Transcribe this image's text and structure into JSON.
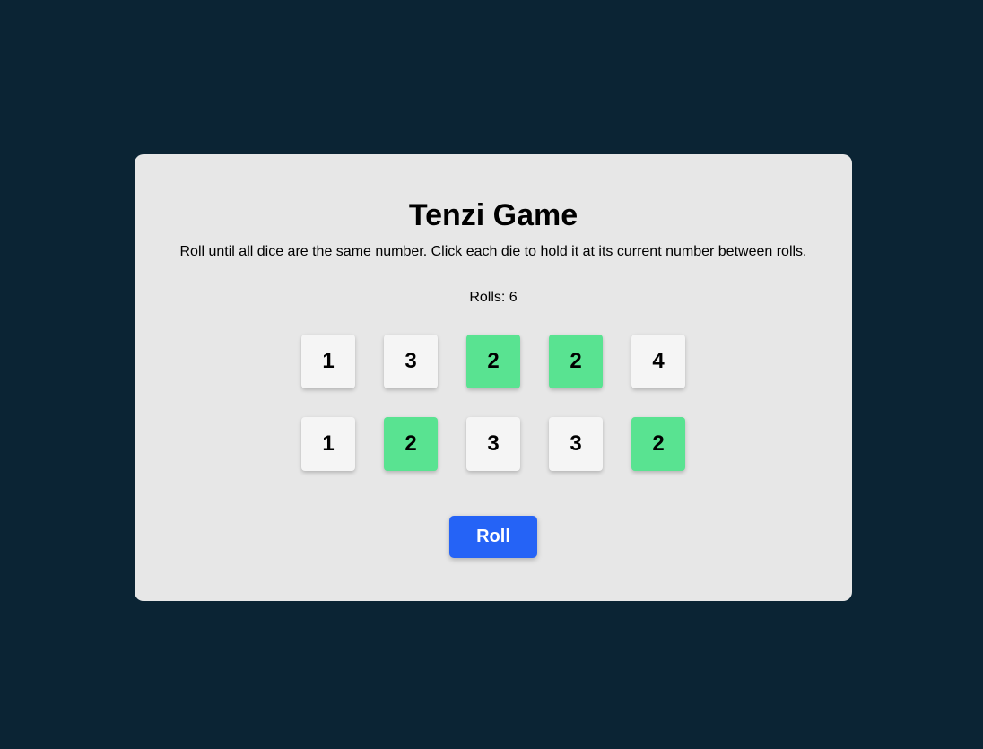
{
  "title": "Tenzi Game",
  "instructions": "Roll until all dice are the same number. Click each die to hold it at its current number between rolls.",
  "rolls_label": "Rolls: 6",
  "dice": [
    {
      "value": "1",
      "held": false
    },
    {
      "value": "3",
      "held": false
    },
    {
      "value": "2",
      "held": true
    },
    {
      "value": "2",
      "held": true
    },
    {
      "value": "4",
      "held": false
    },
    {
      "value": "1",
      "held": false
    },
    {
      "value": "2",
      "held": true
    },
    {
      "value": "3",
      "held": false
    },
    {
      "value": "3",
      "held": false
    },
    {
      "value": "2",
      "held": true
    }
  ],
  "roll_button_label": "Roll",
  "colors": {
    "background": "#0b2434",
    "card": "#e7e7e7",
    "die": "#f5f5f5",
    "die_held": "#59e391",
    "button": "#2563f6"
  }
}
